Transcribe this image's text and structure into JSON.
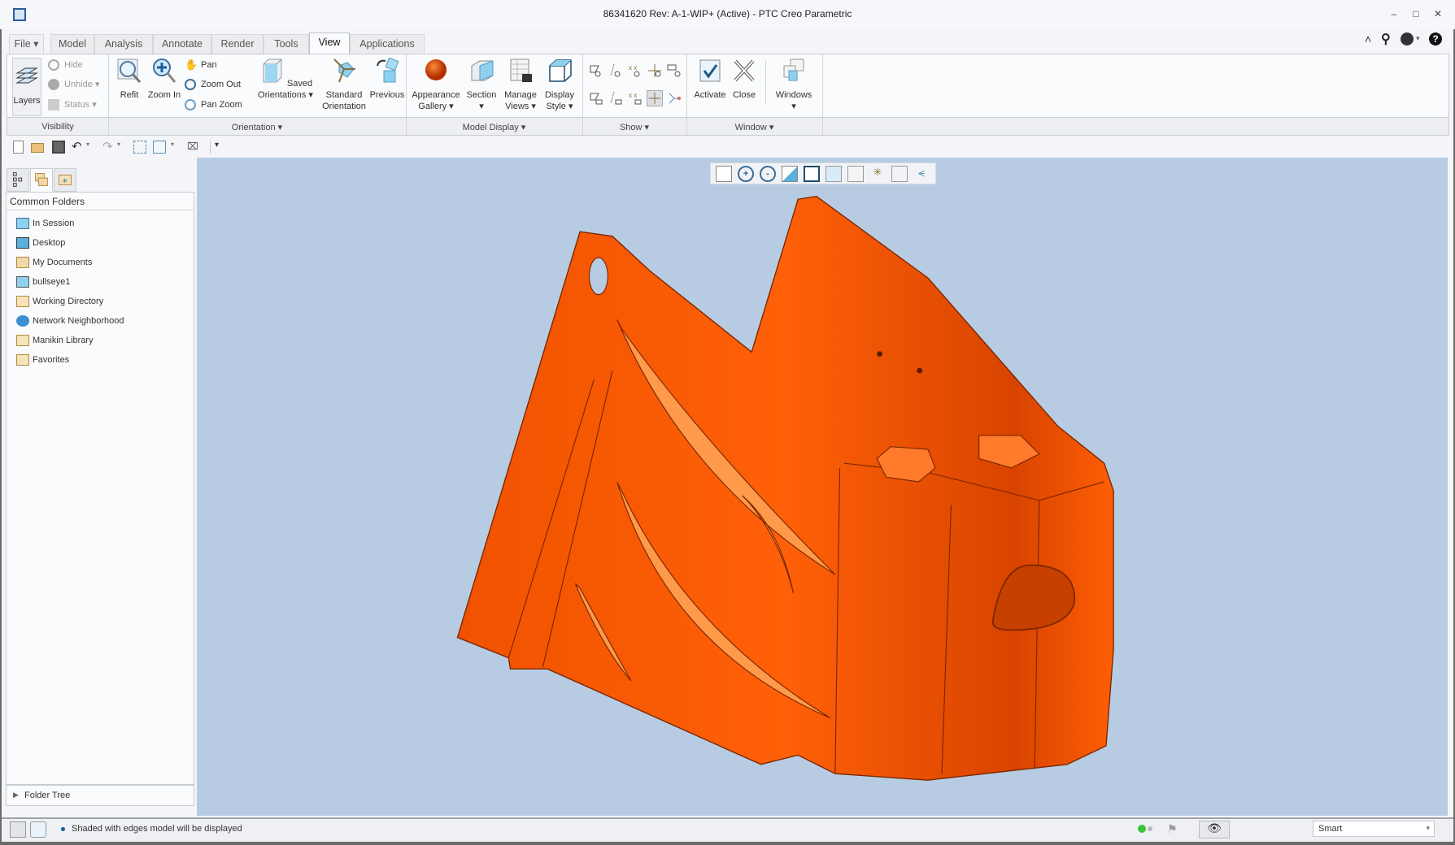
{
  "window": {
    "title": "86341620 Rev: A-1-WIP+ (Active) - PTC Creo Parametric",
    "minimize": "–",
    "restore": "□",
    "close": "✕"
  },
  "tabs": [
    {
      "label": "File ▾"
    },
    {
      "label": "Model"
    },
    {
      "label": "Analysis"
    },
    {
      "label": "Annotate"
    },
    {
      "label": "Render"
    },
    {
      "label": "Tools"
    },
    {
      "label": "View",
      "active": true
    },
    {
      "label": "Applications"
    }
  ],
  "ribbon": {
    "visibility": {
      "layers": "Layers",
      "hide": "Hide",
      "unhide": "Unhide ▾",
      "status": "Status ▾",
      "label": "Visibility"
    },
    "orientation": {
      "refit": "Refit",
      "zoom_in": "Zoom In",
      "pan": "Pan",
      "zoom_out": "Zoom Out",
      "pan_zoom": "Pan Zoom",
      "saved_1": "Saved",
      "saved_2": "Orientations ▾",
      "standard_1": "Standard",
      "standard_2": "Orientation",
      "previous": "Previous",
      "label": "Orientation ▾"
    },
    "model_display": {
      "appearance_1": "Appearance",
      "appearance_2": "Gallery ▾",
      "section_1": "Section",
      "section_2": "▾",
      "manage_1": "Manage",
      "manage_2": "Views ▾",
      "display_1": "Display",
      "display_2": "Style ▾",
      "label": "Model Display ▾"
    },
    "show": {
      "label": "Show ▾"
    },
    "window": {
      "activate": "Activate",
      "close": "Close",
      "windows": "Windows",
      "windows_arrow": "▾",
      "label": "Window ▾"
    }
  },
  "left_panel": {
    "header": "Common Folders",
    "items": [
      {
        "label": "In Session",
        "icon": "monitor"
      },
      {
        "label": "Desktop",
        "icon": "desktop"
      },
      {
        "label": "My Documents",
        "icon": "documents-folder"
      },
      {
        "label": "bullseye1",
        "icon": "computer"
      },
      {
        "label": "Working Directory",
        "icon": "folder-star"
      },
      {
        "label": "Network Neighborhood",
        "icon": "network"
      },
      {
        "label": "Manikin Library",
        "icon": "library-folder"
      },
      {
        "label": "Favorites",
        "icon": "favorites-folder"
      }
    ],
    "folder_tree": "Folder Tree"
  },
  "status": {
    "message": "Shaded with edges model will be displayed",
    "filter": "Smart"
  },
  "colors": {
    "model": "#ff5a00",
    "viewport": "#b7cce2",
    "accent": "#2a7fc1"
  }
}
